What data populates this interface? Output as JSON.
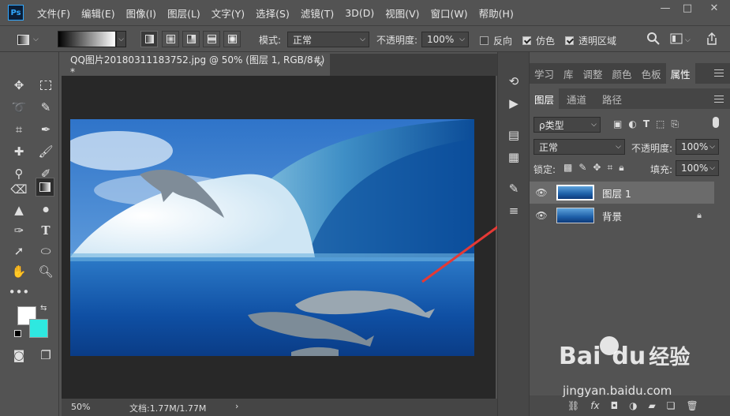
{
  "menubar": {
    "logo": "Ps",
    "items": [
      "文件(F)",
      "编辑(E)",
      "图像(I)",
      "图层(L)",
      "文字(Y)",
      "选择(S)",
      "滤镜(T)",
      "3D(D)",
      "视图(V)",
      "窗口(W)",
      "帮助(H)"
    ],
    "minimize": "—",
    "maximize": "□",
    "close": "✕"
  },
  "options": {
    "mode_label": "模式:",
    "mode_value": "正常",
    "opacity_label": "不透明度:",
    "opacity_value": "100%",
    "reverse": "反向",
    "dither": "仿色",
    "transparency": "透明区域"
  },
  "document": {
    "tab_title": "QQ图片20180311183752.jpg @ 50% (图层 1, RGB/8#) *",
    "zoom": "50%",
    "doc_info": "文档:1.77M/1.77M"
  },
  "panels": {
    "top_tabs": [
      "学习",
      "库",
      "调整",
      "颜色",
      "色板",
      "属性"
    ],
    "active_top_tab": "属性",
    "layer_tabs": [
      "图层",
      "通道",
      "路径"
    ],
    "filter_label": "ρ类型",
    "blend_mode": "正常",
    "opacity_label": "不透明度:",
    "opacity_value": "100%",
    "lock_label": "锁定:",
    "fill_label": "填充:",
    "fill_value": "100%",
    "layers": [
      {
        "name": "图层 1",
        "selected": true
      },
      {
        "name": "背景",
        "selected": false,
        "locked": true
      }
    ]
  },
  "watermark": {
    "brand": "Bai",
    "brand2": "du",
    "suffix": "经验",
    "url": "jingyan.baidu.com"
  },
  "colors": {
    "foreground": "#ffffff",
    "background": "#2ee8e0",
    "arrow": "#e53935"
  }
}
